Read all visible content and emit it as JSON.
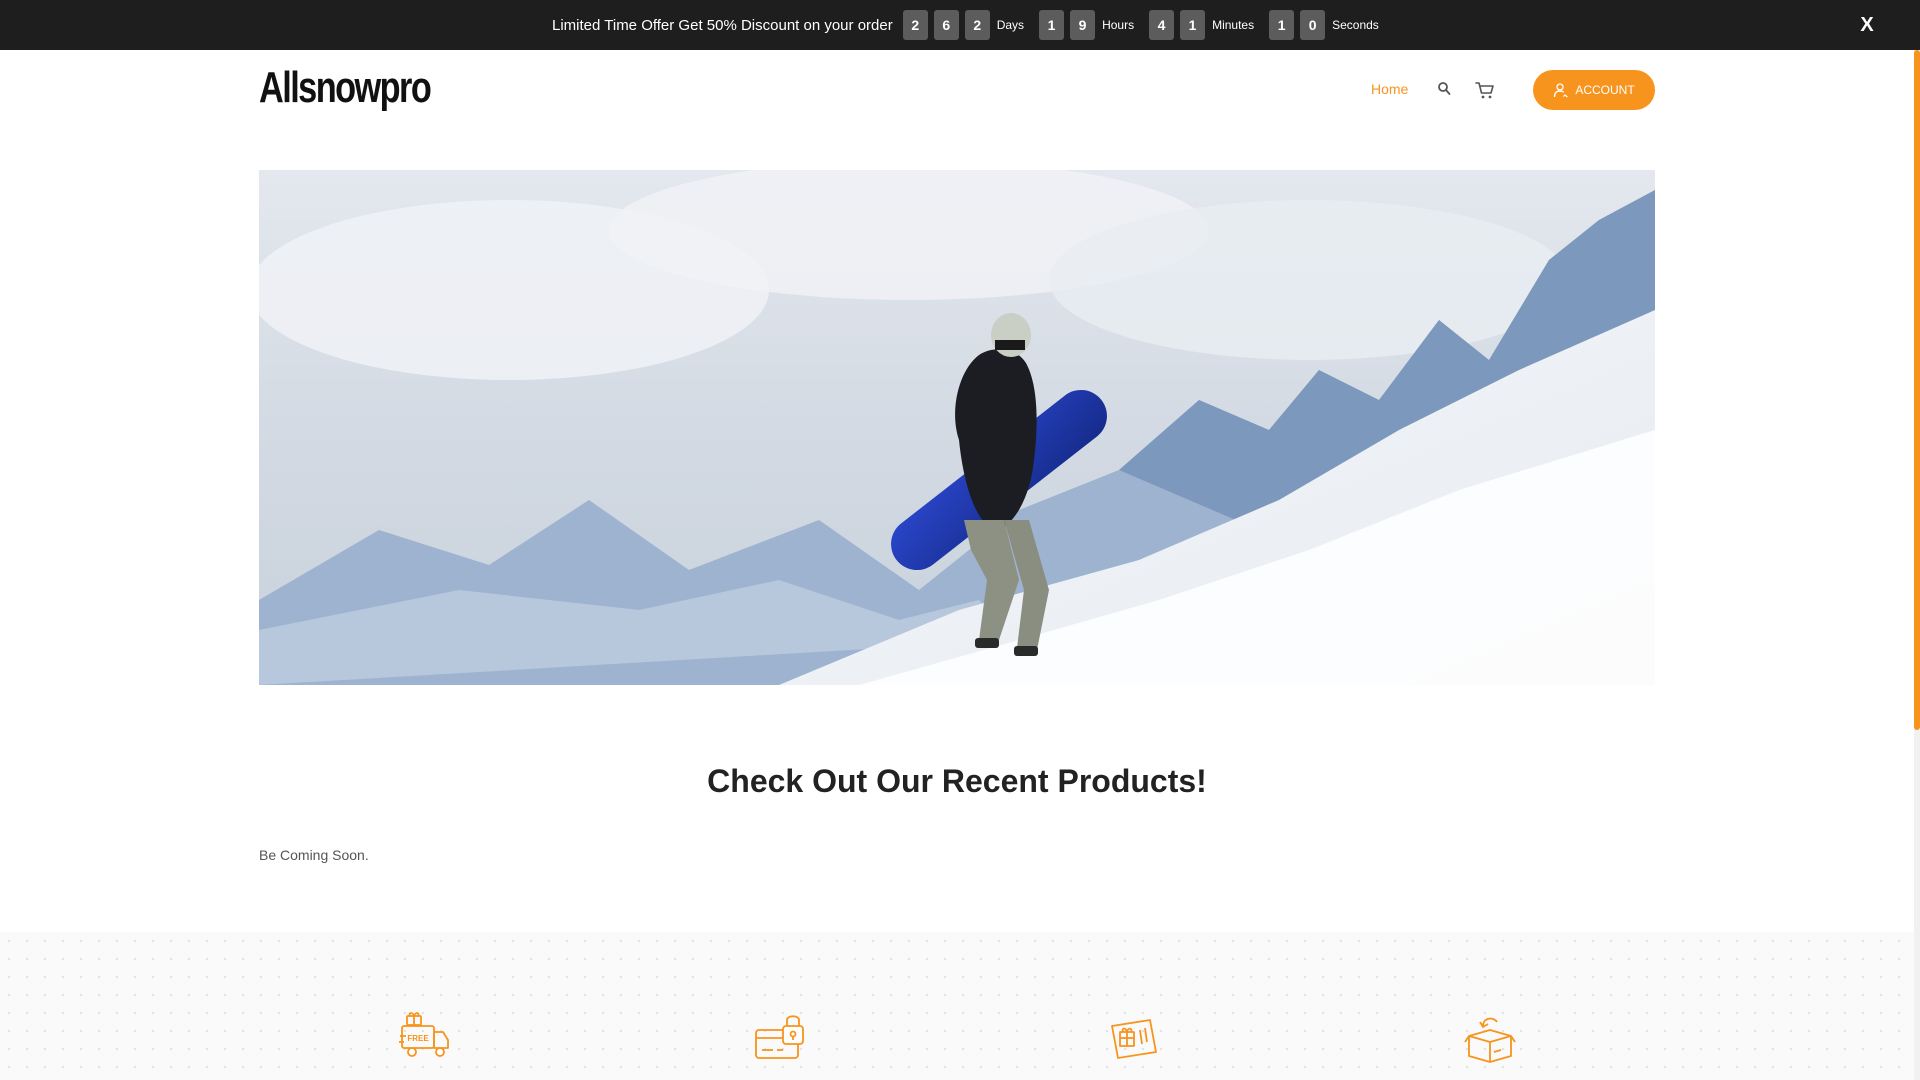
{
  "promo": {
    "text": "Limited Time Offer Get 50% Discount on your order",
    "days_digits": [
      "2",
      "6",
      "2"
    ],
    "days_label": "Days",
    "hours_digits": [
      "1",
      "9"
    ],
    "hours_label": "Hours",
    "minutes_digits": [
      "4",
      "1"
    ],
    "minutes_label": "Minutes",
    "seconds_digits": [
      "1",
      "0"
    ],
    "seconds_label": "Seconds",
    "close_label": "X"
  },
  "header": {
    "logo_text": "Allsnowpro",
    "nav_home": "Home",
    "account_label": "ACCOUNT"
  },
  "products": {
    "title": "Check Out Our Recent Products!",
    "message": "Be Coming Soon."
  },
  "features": {
    "icons": [
      "free-shipping-truck-icon",
      "secure-payment-card-icon",
      "gift-card-icon",
      "easy-returns-box-icon"
    ],
    "free_badge": "FREE"
  },
  "colors": {
    "accent": "#f7941d",
    "promo_bg": "#1e1e1e",
    "digit_bg": "#5c5c5c",
    "text_dark": "#222222"
  }
}
